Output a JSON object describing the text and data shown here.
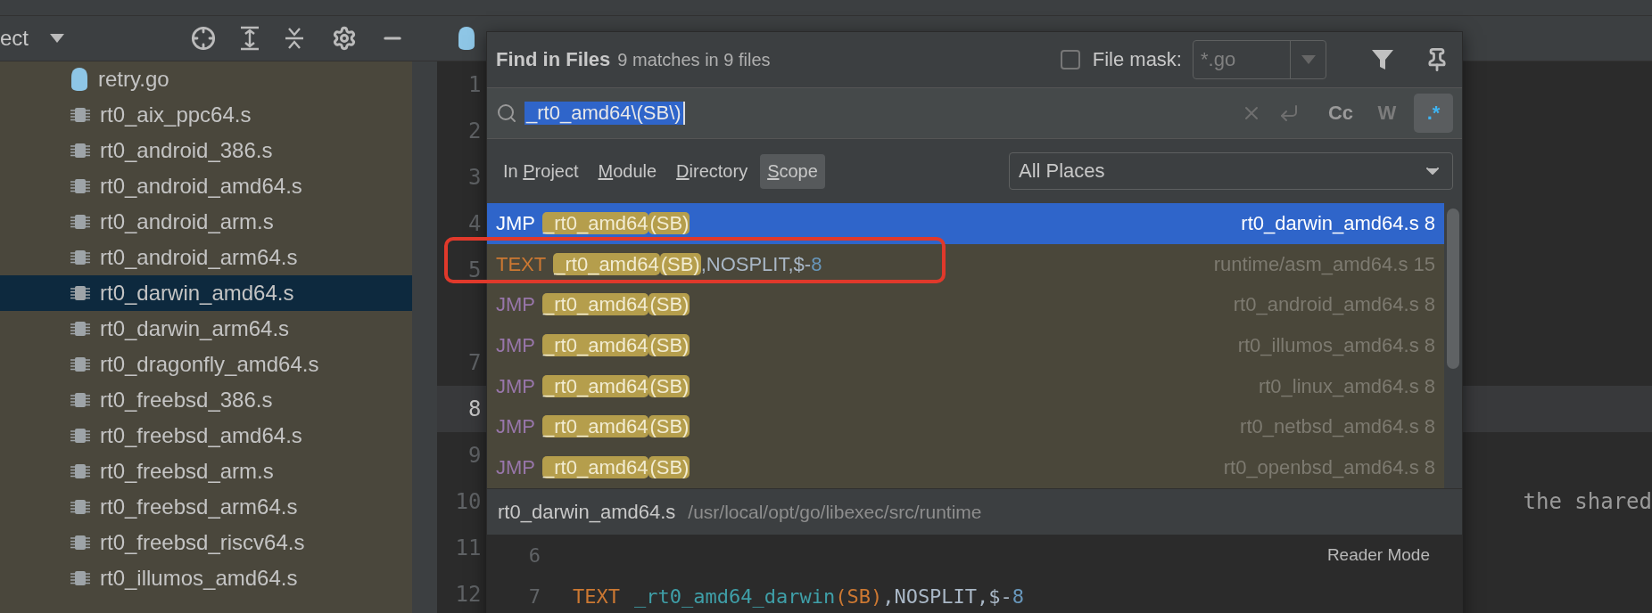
{
  "project_panel": {
    "title": "ect",
    "files": [
      {
        "name": "retry.go",
        "kind": "go",
        "selected": false
      },
      {
        "name": "rt0_aix_ppc64.s",
        "kind": "asm",
        "selected": false
      },
      {
        "name": "rt0_android_386.s",
        "kind": "asm",
        "selected": false
      },
      {
        "name": "rt0_android_amd64.s",
        "kind": "asm",
        "selected": false
      },
      {
        "name": "rt0_android_arm.s",
        "kind": "asm",
        "selected": false
      },
      {
        "name": "rt0_android_arm64.s",
        "kind": "asm",
        "selected": false
      },
      {
        "name": "rt0_darwin_amd64.s",
        "kind": "asm",
        "selected": true
      },
      {
        "name": "rt0_darwin_arm64.s",
        "kind": "asm",
        "selected": false
      },
      {
        "name": "rt0_dragonfly_amd64.s",
        "kind": "asm",
        "selected": false
      },
      {
        "name": "rt0_freebsd_386.s",
        "kind": "asm",
        "selected": false
      },
      {
        "name": "rt0_freebsd_amd64.s",
        "kind": "asm",
        "selected": false
      },
      {
        "name": "rt0_freebsd_arm.s",
        "kind": "asm",
        "selected": false
      },
      {
        "name": "rt0_freebsd_arm64.s",
        "kind": "asm",
        "selected": false
      },
      {
        "name": "rt0_freebsd_riscv64.s",
        "kind": "asm",
        "selected": false
      },
      {
        "name": "rt0_illumos_amd64.s",
        "kind": "asm",
        "selected": false
      }
    ]
  },
  "editor": {
    "lines": [
      {
        "number": "1",
        "current": false
      },
      {
        "number": "2",
        "current": false
      },
      {
        "number": "3",
        "current": false
      },
      {
        "number": "4",
        "current": false
      },
      {
        "number": "5",
        "current": false
      },
      {
        "current": false
      },
      {
        "number": "7",
        "current": false
      },
      {
        "number": "8",
        "current": true
      },
      {
        "number": "9",
        "current": false
      },
      {
        "number": "10",
        "current": false,
        "text": "the shared"
      },
      {
        "number": "11",
        "current": false
      },
      {
        "number": "12",
        "current": false
      }
    ]
  },
  "find_dialog": {
    "title": "Find in Files",
    "summary": "9 matches in 9 files",
    "file_mask": {
      "checked": false,
      "label": "File mask:",
      "value": "*.go"
    },
    "search": {
      "value": "_rt0_amd64\\(SB\\)"
    },
    "options": [
      {
        "label": "Cc",
        "on": false,
        "disabled": false
      },
      {
        "label": "W",
        "on": false,
        "disabled": true
      },
      {
        "label": ".*",
        "on": true,
        "disabled": false
      }
    ],
    "scopes": [
      {
        "parts": [
          {
            "text": "In ",
            "underline": false
          },
          {
            "text": "P",
            "underline": true
          },
          {
            "text": "roject",
            "underline": false
          }
        ],
        "selected": false
      },
      {
        "parts": [
          {
            "text": "M",
            "underline": true
          },
          {
            "text": "odule",
            "underline": false
          }
        ],
        "selected": false
      },
      {
        "parts": [
          {
            "text": "D",
            "underline": true
          },
          {
            "text": "irectory",
            "underline": false
          }
        ],
        "selected": false
      },
      {
        "parts": [
          {
            "text": "S",
            "underline": true
          },
          {
            "text": "cope",
            "underline": false
          }
        ],
        "selected": true
      }
    ],
    "scope_dropdown": "All Places",
    "results": [
      {
        "selected": true,
        "code": [
          {
            "kind": "jmp",
            "text": "JMP"
          },
          {
            "kind": "match",
            "text": "_rt0_amd64"
          },
          {
            "kind": "match",
            "text": "(SB)"
          }
        ],
        "file": "rt0_darwin_amd64.s 8"
      },
      {
        "selected": false,
        "code": [
          {
            "kind": "text",
            "text": "TEXT"
          },
          {
            "kind": "match",
            "text": "_rt0_amd64"
          },
          {
            "kind": "match",
            "text": "(SB)"
          },
          {
            "kind": "plain",
            "text": ",NOSPLIT,$-"
          },
          {
            "kind": "number",
            "text": "8"
          }
        ],
        "file": "runtime/asm_amd64.s 15"
      },
      {
        "selected": false,
        "code": [
          {
            "kind": "jmp",
            "text": "JMP"
          },
          {
            "kind": "match",
            "text": "_rt0_amd64"
          },
          {
            "kind": "match",
            "text": "(SB)"
          }
        ],
        "file": "rt0_android_amd64.s 8"
      },
      {
        "selected": false,
        "code": [
          {
            "kind": "jmp",
            "text": "JMP"
          },
          {
            "kind": "match",
            "text": "_rt0_amd64"
          },
          {
            "kind": "match",
            "text": "(SB)"
          }
        ],
        "file": "rt0_illumos_amd64.s 8"
      },
      {
        "selected": false,
        "code": [
          {
            "kind": "jmp",
            "text": "JMP"
          },
          {
            "kind": "match",
            "text": "_rt0_amd64"
          },
          {
            "kind": "match",
            "text": "(SB)"
          }
        ],
        "file": "rt0_linux_amd64.s 8"
      },
      {
        "selected": false,
        "code": [
          {
            "kind": "jmp",
            "text": "JMP"
          },
          {
            "kind": "match",
            "text": "_rt0_amd64"
          },
          {
            "kind": "match",
            "text": "(SB)"
          }
        ],
        "file": "rt0_netbsd_amd64.s 8"
      },
      {
        "selected": false,
        "code": [
          {
            "kind": "jmp",
            "text": "JMP"
          },
          {
            "kind": "match",
            "text": "_rt0_amd64"
          },
          {
            "kind": "match",
            "text": "(SB)"
          }
        ],
        "file": "rt0_openbsd_amd64.s 8"
      }
    ],
    "preview": {
      "file": "rt0_darwin_amd64.s",
      "path": "/usr/local/opt/go/libexec/src/runtime",
      "reader_mode": "Reader Mode",
      "lines": [
        {
          "number": "6"
        },
        {
          "number": "7",
          "code": [
            {
              "kind": "text",
              "text": "TEXT"
            },
            {
              "kind": "symbol",
              "text": "_rt0_amd64_darwin"
            },
            {
              "kind": "register",
              "text": "(SB)"
            },
            {
              "kind": "plain",
              "text": ",NOSPLIT,$-"
            },
            {
              "kind": "number",
              "text": "8"
            }
          ]
        }
      ]
    }
  }
}
